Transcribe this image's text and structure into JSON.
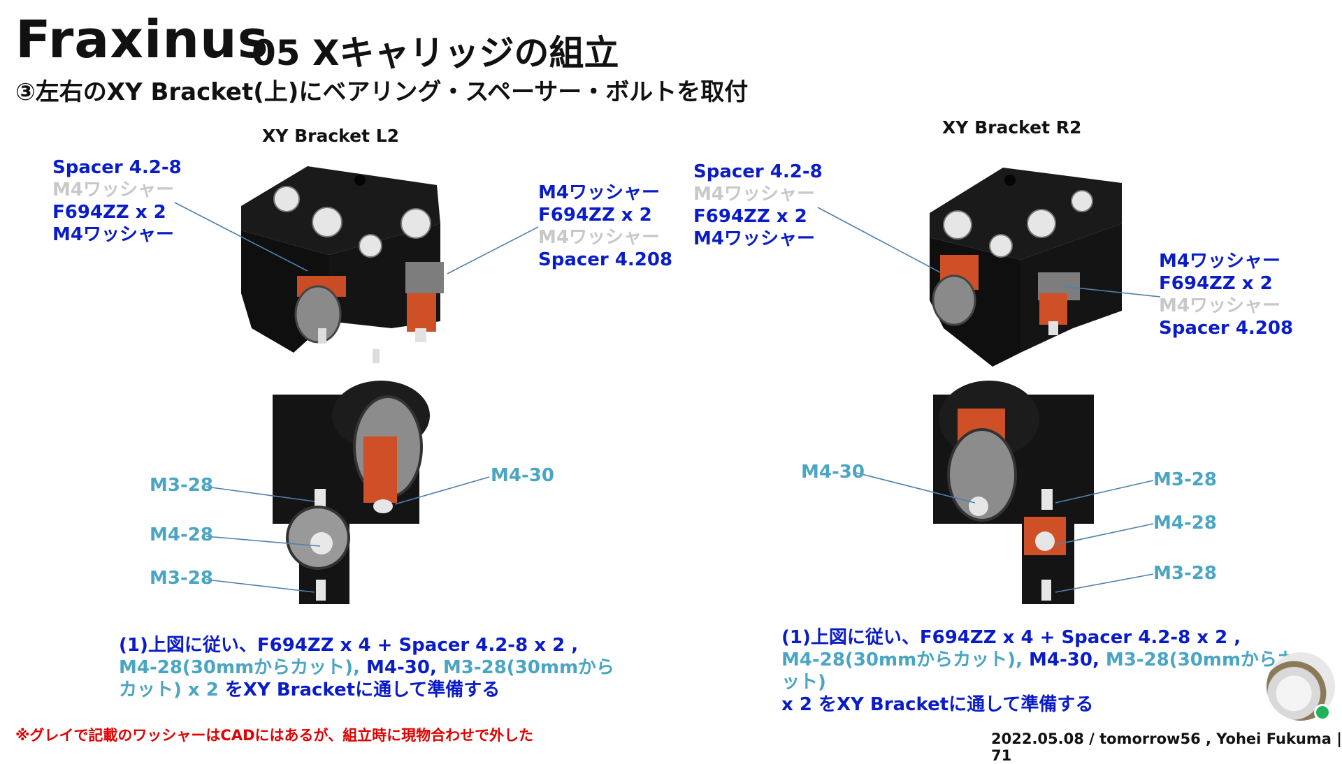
{
  "header": {
    "title": "Fraxinus",
    "subtitle": "05 Xキャリッジの組立",
    "step": "③左右のXY Bracket(上)にベアリング・スペーサー・ボルトを取付"
  },
  "left": {
    "caption": "XY Bracket L2",
    "top_left_labels": [
      "Spacer 4.2-8",
      "M4ワッシャー",
      "F694ZZ x 2",
      "M4ワッシャー"
    ],
    "top_right_labels": [
      "M4ワッシャー",
      "F694ZZ x 2",
      "M4ワッシャー",
      "Spacer 4.208"
    ],
    "bolt_labels": {
      "m4_30": "M4-30",
      "m3_28_a": "M3-28",
      "m4_28": "M4-28",
      "m3_28_b": "M3-28"
    },
    "instruction": {
      "part1": "(1)上図に従い、F694ZZ x 4 + Spacer 4.2-8 x 2 ,",
      "part2": "M4-28(30mmからカット),",
      "part3": " M4-30, ",
      "part4": "M3-28(30mmからカット) x 2",
      "part5": " をXY Bracketに通して準備する"
    }
  },
  "right": {
    "caption": "XY Bracket R2",
    "top_left_labels": [
      "Spacer 4.2-8",
      "M4ワッシャー",
      "F694ZZ x 2",
      "M4ワッシャー"
    ],
    "top_right_labels": [
      "M4ワッシャー",
      "F694ZZ x 2",
      "M4ワッシャー",
      "Spacer 4.208"
    ],
    "bolt_labels": {
      "m4_30": "M4-30",
      "m3_28_a": "M3-28",
      "m4_28": "M4-28",
      "m3_28_b": "M3-28"
    },
    "instruction": {
      "part1": "(1)上図に従い、F694ZZ x 4 + Spacer 4.2-8 x 2 ,",
      "part2": "M4-28(30mmからカット),",
      "part3": " M4-30, ",
      "part4": "M3-28(30mmからカット)",
      "part5": "x 2 をXY Bracketに通して準備する"
    }
  },
  "note": "※グレイで記載のワッシャーはCADにはあるが、組立時に現物合わせで外した",
  "footer": "2022.05.08 / tomorrow56 , Yohei Fukuma | 71",
  "colors": {
    "label_blue": "#0a1cc8",
    "label_grey": "#c8c8c8",
    "label_teal": "#4aa5c4",
    "note_red": "#e00000",
    "part_black": "#141414",
    "part_orange": "#d9542a"
  }
}
